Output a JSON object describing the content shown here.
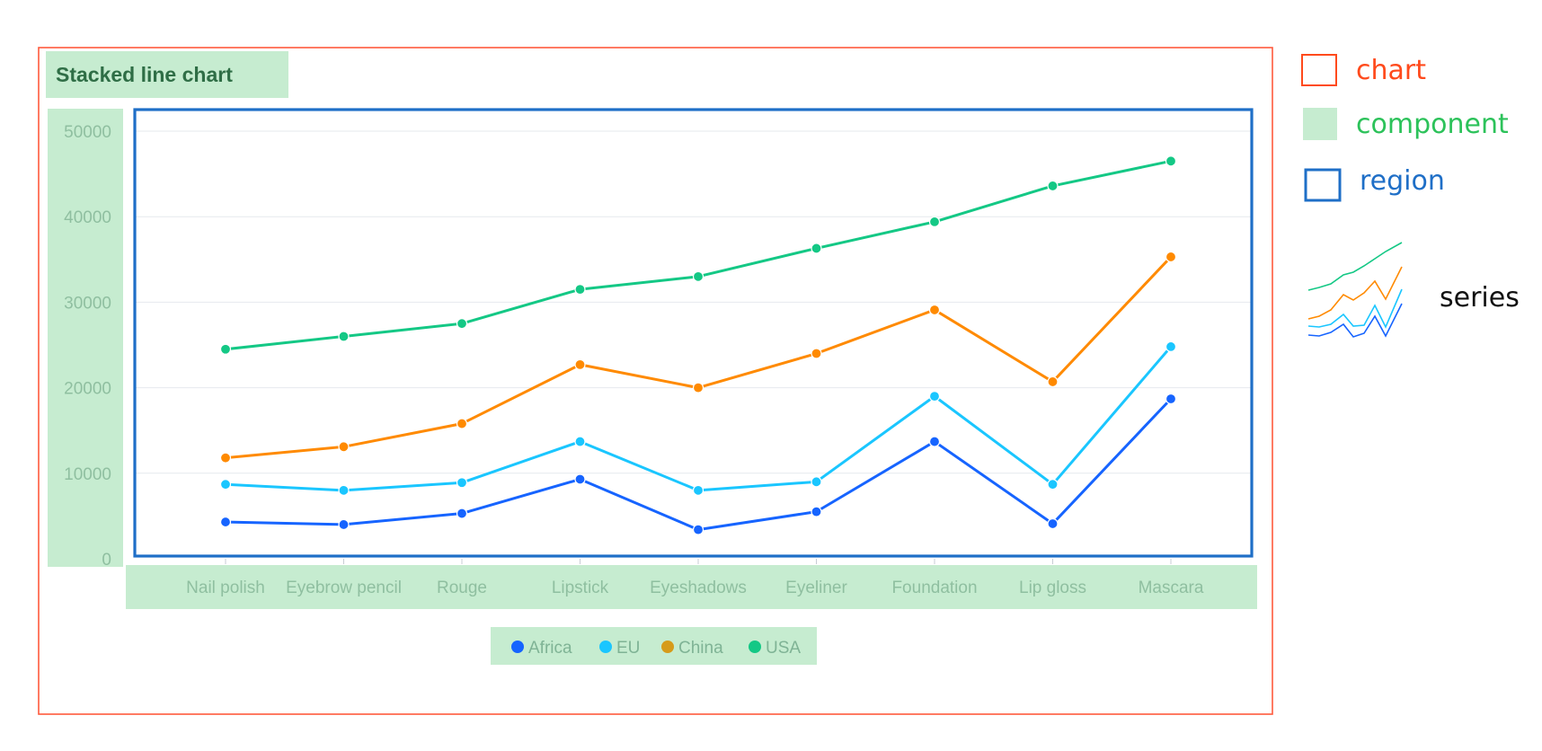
{
  "chart_data": {
    "type": "line",
    "title": "Stacked line chart",
    "stacked": true,
    "categories": [
      "Nail polish",
      "Eyebrow pencil",
      "Rouge",
      "Lipstick",
      "Eyeshadows",
      "Eyeliner",
      "Foundation",
      "Lip gloss",
      "Mascara"
    ],
    "y_ticks": [
      "0",
      "10000",
      "20000",
      "30000",
      "40000",
      "50000"
    ],
    "ylim": [
      0,
      50000
    ],
    "grid": true,
    "legend_position": "bottom",
    "series": [
      {
        "name": "Africa",
        "color": "#1664ff",
        "values": [
          4300,
          4000,
          5300,
          9300,
          3400,
          5500,
          13700,
          4100,
          18700
        ]
      },
      {
        "name": "EU",
        "color": "#1ac6ff",
        "values": [
          8700,
          8000,
          8900,
          13700,
          8000,
          9000,
          19000,
          8700,
          24800
        ]
      },
      {
        "name": "China",
        "color": "#ff8a00",
        "values": [
          11800,
          13100,
          15800,
          22700,
          20000,
          24000,
          29100,
          20700,
          35300
        ]
      },
      {
        "name": "USA",
        "color": "#14c885",
        "values": [
          24500,
          26000,
          27500,
          31500,
          33000,
          36300,
          39400,
          43600,
          46500
        ]
      }
    ],
    "legend_dot_colors": [
      "#1664ff",
      "#1ac6ff",
      "#d69b1a",
      "#14c885"
    ]
  },
  "annotation_legend": {
    "items": [
      {
        "label": "chart",
        "color": "#ff4a1c",
        "marker": "outlined-square"
      },
      {
        "label": "component",
        "color": "#2cc25a",
        "marker": "filled-square"
      },
      {
        "label": "region",
        "color": "#1f6fc7",
        "marker": "outlined-square"
      },
      {
        "label": "series",
        "color": "#111111",
        "marker": "mini-line-chart"
      }
    ]
  }
}
